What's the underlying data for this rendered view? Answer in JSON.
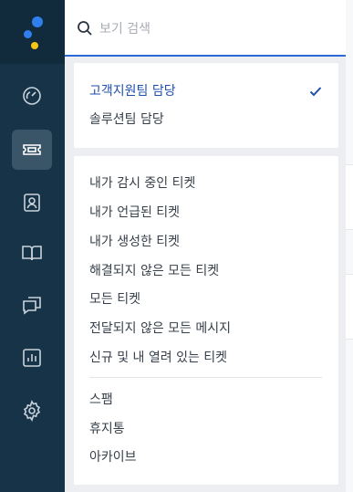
{
  "search": {
    "placeholder": "보기 검색"
  },
  "assignment_group": {
    "items": [
      {
        "label": "고객지원팀 담당",
        "selected": true
      },
      {
        "label": "솔루션팀 담당",
        "selected": false
      }
    ]
  },
  "views_group": {
    "items": [
      {
        "label": "내가 감시 중인 티켓"
      },
      {
        "label": "내가 언급된 티켓"
      },
      {
        "label": "내가 생성한 티켓"
      },
      {
        "label": "해결되지 않은 모든 티켓"
      },
      {
        "label": "모든 티켓"
      },
      {
        "label": "전달되지 않은 모든 메시지"
      },
      {
        "label": "신규 및 내 열려 있는 티켓"
      }
    ],
    "secondary_items": [
      {
        "label": "스팸"
      },
      {
        "label": "휴지통"
      },
      {
        "label": "아카이브"
      }
    ]
  },
  "sidebar": {
    "items": [
      {
        "icon": "dashboard-icon"
      },
      {
        "icon": "ticket-icon",
        "active": true
      },
      {
        "icon": "contacts-icon"
      },
      {
        "icon": "knowledge-base-icon"
      },
      {
        "icon": "conversations-icon"
      },
      {
        "icon": "reports-icon"
      },
      {
        "icon": "settings-icon"
      }
    ]
  },
  "colors": {
    "sidebar": "#173347",
    "accent": "#2c6bd7",
    "selected_text": "#1f4fae",
    "logo_blue": "#2f80ed",
    "logo_yellow": "#f5c518"
  }
}
